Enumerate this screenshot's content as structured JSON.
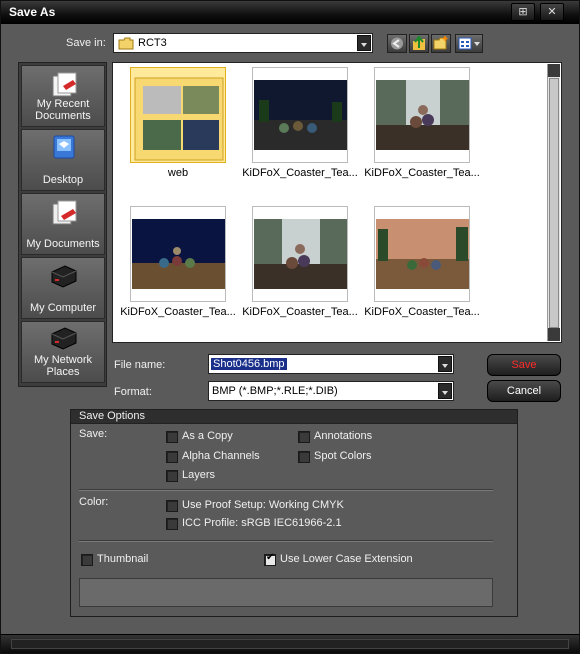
{
  "window": {
    "title": "Save As"
  },
  "titlebar": {
    "help_glyph": "⊞",
    "close_glyph": "✕"
  },
  "save_in": {
    "label": "Save in:",
    "value": "RCT3"
  },
  "places": [
    {
      "label": "My Recent Documents",
      "icon": "recent-documents-icon"
    },
    {
      "label": "Desktop",
      "icon": "desktop-icon"
    },
    {
      "label": "My Documents",
      "icon": "my-documents-icon"
    },
    {
      "label": "My Computer",
      "icon": "my-computer-icon"
    },
    {
      "label": "My Network Places",
      "icon": "network-places-icon"
    }
  ],
  "files": [
    {
      "name": "web",
      "kind": "folder"
    },
    {
      "name": "KiDFoX_Coaster_Tea...",
      "kind": "image"
    },
    {
      "name": "KiDFoX_Coaster_Tea...",
      "kind": "image"
    },
    {
      "name": "KiDFoX_Coaster_Tea...",
      "kind": "image"
    },
    {
      "name": "KiDFoX_Coaster_Tea...",
      "kind": "image"
    },
    {
      "name": "KiDFoX_Coaster_Tea...",
      "kind": "image"
    }
  ],
  "file_name": {
    "label": "File name:",
    "value": "Shot0456.bmp"
  },
  "format": {
    "label": "Format:",
    "value": "BMP (*.BMP;*.RLE;*.DIB)"
  },
  "buttons": {
    "save": "Save",
    "cancel": "Cancel"
  },
  "save_options": {
    "title": "Save Options",
    "save_label": "Save:",
    "as_a_copy": {
      "label": "As a Copy",
      "checked": false
    },
    "annotations": {
      "label": "Annotations",
      "checked": false
    },
    "alpha_channels": {
      "label": "Alpha Channels",
      "checked": false
    },
    "spot_colors": {
      "label": "Spot Colors",
      "checked": false
    },
    "layers": {
      "label": "Layers",
      "checked": false
    },
    "color_label": "Color:",
    "use_proof_setup": {
      "label": "Use Proof Setup:  Working CMYK",
      "checked": false
    },
    "icc_profile": {
      "label": "ICC Profile:  sRGB IEC61966-2.1",
      "checked": false
    },
    "thumbnail": {
      "label": "Thumbnail",
      "checked": false
    },
    "lower_case": {
      "label": "Use Lower Case Extension",
      "checked": true
    }
  },
  "colors": {
    "save_button_text": "#ff2a2a",
    "selection": "#1a2f8a"
  }
}
